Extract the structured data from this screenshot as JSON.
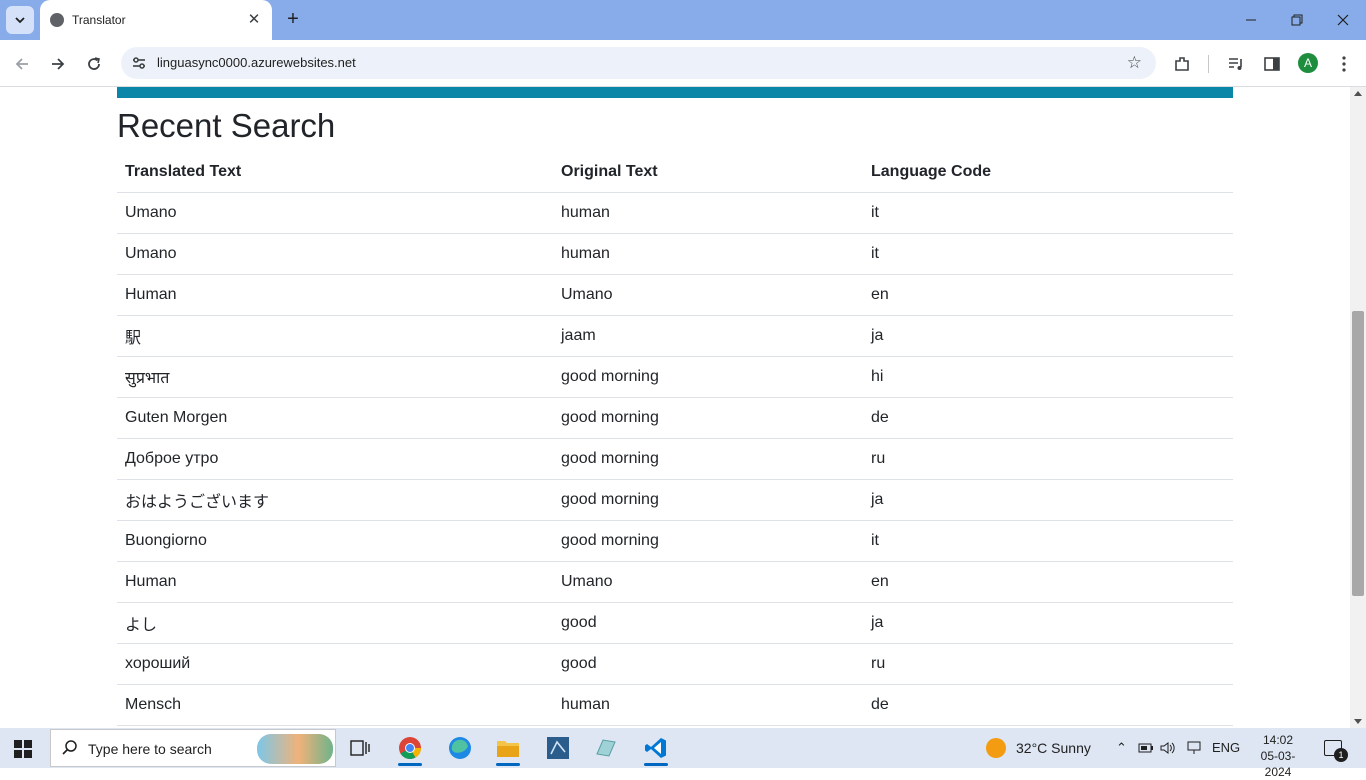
{
  "browser": {
    "tab_title": "Translator",
    "url": "linguasync0000.azurewebsites.net",
    "profile_initial": "A"
  },
  "page": {
    "heading": "Recent Search",
    "columns": [
      "Translated Text",
      "Original Text",
      "Language Code"
    ],
    "rows": [
      {
        "translated": "Umano",
        "original": "human",
        "code": "it"
      },
      {
        "translated": "Umano",
        "original": "human",
        "code": "it"
      },
      {
        "translated": "Human",
        "original": "Umano",
        "code": "en"
      },
      {
        "translated": "駅",
        "original": "jaam",
        "code": "ja"
      },
      {
        "translated": "सुप्रभात",
        "original": "good morning",
        "code": "hi"
      },
      {
        "translated": "Guten Morgen",
        "original": "good morning",
        "code": "de"
      },
      {
        "translated": "Доброе утро",
        "original": "good morning",
        "code": "ru"
      },
      {
        "translated": "おはようございます",
        "original": "good morning",
        "code": "ja"
      },
      {
        "translated": "Buongiorno",
        "original": "good morning",
        "code": "it"
      },
      {
        "translated": "Human",
        "original": "Umano",
        "code": "en"
      },
      {
        "translated": "よし",
        "original": "good",
        "code": "ja"
      },
      {
        "translated": "хороший",
        "original": "good",
        "code": "ru"
      },
      {
        "translated": "Mensch",
        "original": "human",
        "code": "de"
      }
    ]
  },
  "taskbar": {
    "search_placeholder": "Type here to search",
    "weather": "32°C  Sunny",
    "language": "ENG",
    "time": "14:02",
    "date": "05-03-2024",
    "notification_count": "1"
  },
  "colors": {
    "accent_bar": "#0b85a8",
    "titlebar": "#87ace9"
  }
}
